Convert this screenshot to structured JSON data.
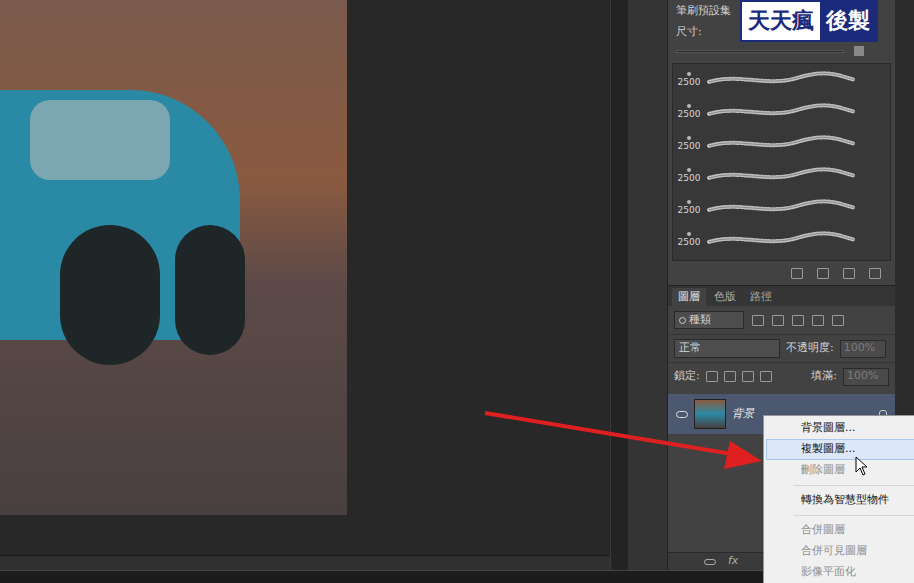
{
  "watermark": {
    "left": "天天瘋",
    "right": "後製"
  },
  "brush_panel": {
    "title": "筆刷預設集",
    "size_label": "尺寸:",
    "brushes": [
      {
        "size": "2500"
      },
      {
        "size": "2500"
      },
      {
        "size": "2500"
      },
      {
        "size": "2500"
      },
      {
        "size": "2500"
      },
      {
        "size": "2500"
      }
    ]
  },
  "layers_panel": {
    "tabs": [
      {
        "label": "圖層",
        "selected": true
      },
      {
        "label": "色版",
        "selected": false
      },
      {
        "label": "路徑",
        "selected": false
      }
    ],
    "filter": {
      "value": "種類"
    },
    "blend_mode": {
      "value": "正常"
    },
    "opacity": {
      "label": "不透明度:",
      "value": "100%",
      "disabled": true
    },
    "lock": {
      "label": "鎖定:"
    },
    "fill": {
      "label": "填滿:",
      "value": "100%",
      "disabled": true
    },
    "layers": [
      {
        "name": "背景",
        "visible": true,
        "selected": true,
        "locked": true
      }
    ]
  },
  "context_menu": {
    "items": [
      {
        "label": "背景圖層...",
        "disabled": false,
        "hovered": false,
        "separator_after": false
      },
      {
        "label": "複製圖層...",
        "disabled": false,
        "hovered": true,
        "separator_after": false
      },
      {
        "label": "刪除圖層",
        "disabled": true,
        "hovered": false,
        "separator_after": true
      },
      {
        "label": "轉換為智慧型物件",
        "disabled": false,
        "hovered": false,
        "separator_after": true
      },
      {
        "label": "合併圖層",
        "disabled": true,
        "hovered": false,
        "separator_after": false
      },
      {
        "label": "合併可見圖層",
        "disabled": true,
        "hovered": false,
        "separator_after": false
      },
      {
        "label": "影像平面化",
        "disabled": true,
        "hovered": false,
        "separator_after": false
      }
    ]
  },
  "bottom_bar": {
    "fx": "fx"
  }
}
